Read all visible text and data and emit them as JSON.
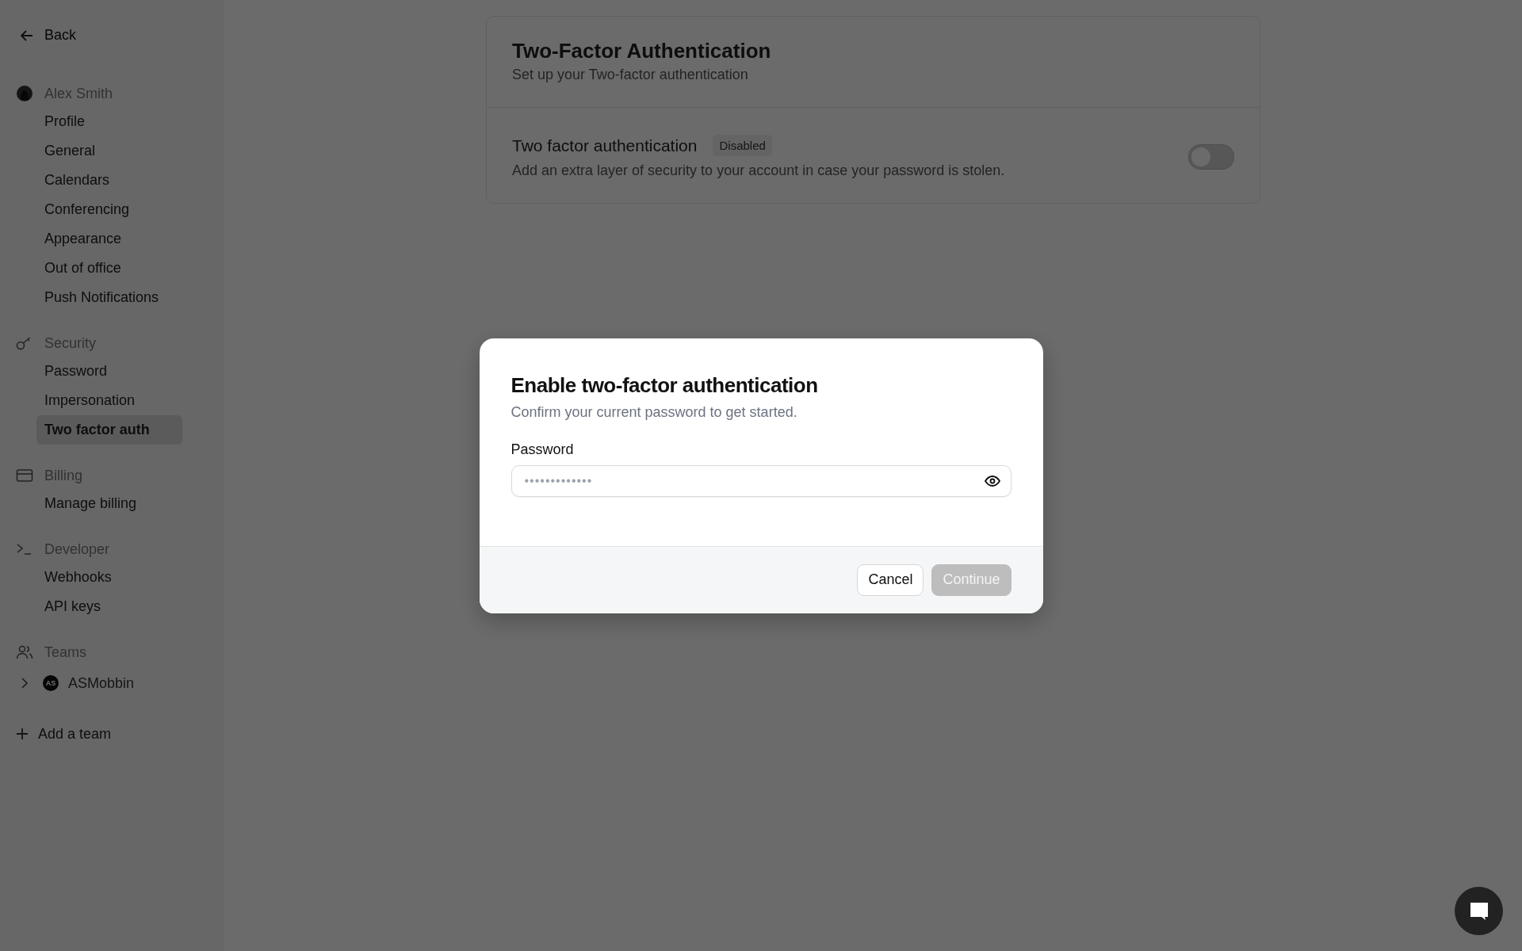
{
  "sidebar": {
    "back": "Back",
    "sections": [
      {
        "kind": "user",
        "label": "Alex Smith",
        "items": [
          {
            "label": "Profile",
            "selected": false
          },
          {
            "label": "General",
            "selected": false
          },
          {
            "label": "Calendars",
            "selected": false
          },
          {
            "label": "Conferencing",
            "selected": false
          },
          {
            "label": "Appearance",
            "selected": false
          },
          {
            "label": "Out of office",
            "selected": false
          },
          {
            "label": "Push Notifications",
            "selected": false
          }
        ]
      },
      {
        "kind": "security",
        "label": "Security",
        "items": [
          {
            "label": "Password",
            "selected": false
          },
          {
            "label": "Impersonation",
            "selected": false
          },
          {
            "label": "Two factor auth",
            "selected": true
          }
        ]
      },
      {
        "kind": "billing",
        "label": "Billing",
        "items": [
          {
            "label": "Manage billing",
            "selected": false
          }
        ]
      },
      {
        "kind": "developer",
        "label": "Developer",
        "items": [
          {
            "label": "Webhooks",
            "selected": false
          },
          {
            "label": "API keys",
            "selected": false
          }
        ]
      },
      {
        "kind": "teams",
        "label": "Teams",
        "teams": [
          {
            "initials": "AS",
            "name": "ASMobbin",
            "expanded": false
          }
        ]
      }
    ],
    "add_team": "Add a team"
  },
  "card": {
    "title": "Two-Factor Authentication",
    "subtitle": "Set up your Two-factor authentication",
    "setting": {
      "label": "Two factor authentication",
      "badge": "Disabled",
      "description": "Add an extra layer of security to your account in case your password is stolen.",
      "on": false
    }
  },
  "dialog": {
    "title": "Enable two-factor authentication",
    "subtitle": "Confirm your current password to get started.",
    "field": {
      "label": "Password",
      "value": "•••••••••••••"
    },
    "buttons": [
      {
        "kind": "secondary",
        "label": "Cancel",
        "disabled": false
      },
      {
        "kind": "primary",
        "label": "Continue",
        "disabled": true
      }
    ]
  }
}
